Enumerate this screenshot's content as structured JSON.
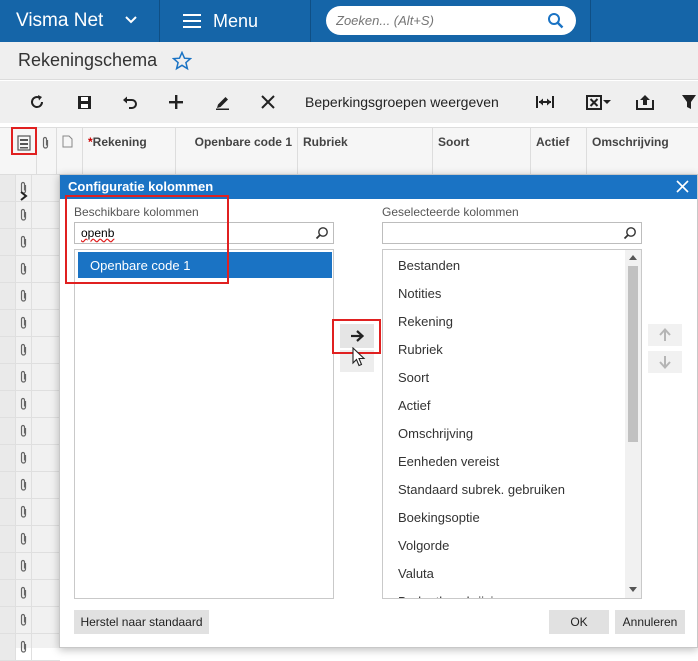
{
  "topbar": {
    "brand": "Visma Net",
    "menu_label": "Menu",
    "search_placeholder": "Zoeken... (Alt+S)"
  },
  "page": {
    "title": "Rekeningschema"
  },
  "toolbar": {
    "restrict_groups_label": "Beperkingsgroepen weergeven"
  },
  "grid": {
    "columns": [
      {
        "label": "Rekening",
        "required": "*"
      },
      {
        "label": "Openbare code 1"
      },
      {
        "label": "Rubriek"
      },
      {
        "label": "Soort"
      },
      {
        "label": "Actief"
      },
      {
        "label": "Omschrijving"
      }
    ]
  },
  "dialog": {
    "title": "Configuratie kolommen",
    "available_label": "Beschikbare kolommen",
    "available_search_value": "openb",
    "available_items": [
      "Openbare code 1"
    ],
    "selected_label": "Geselecteerde kolommen",
    "selected_search_value": "",
    "selected_items": [
      "Bestanden",
      "Notities",
      "Rekening",
      "Rubriek",
      "Soort",
      "Actief",
      "Omschrijving",
      "Eenheden vereist",
      "Standaard subrek. gebruiken",
      "Boekingsoptie",
      "Volgorde",
      "Valuta",
      "Budgetbeschrijving"
    ],
    "reset_button": "Herstel naar standaard",
    "ok_button": "OK",
    "cancel_button": "Annuleren"
  },
  "colors": {
    "topbar": "#1565a8",
    "dialog_header": "#1a73c4",
    "selection": "#1a73c4",
    "highlight_box": "#e02020"
  }
}
